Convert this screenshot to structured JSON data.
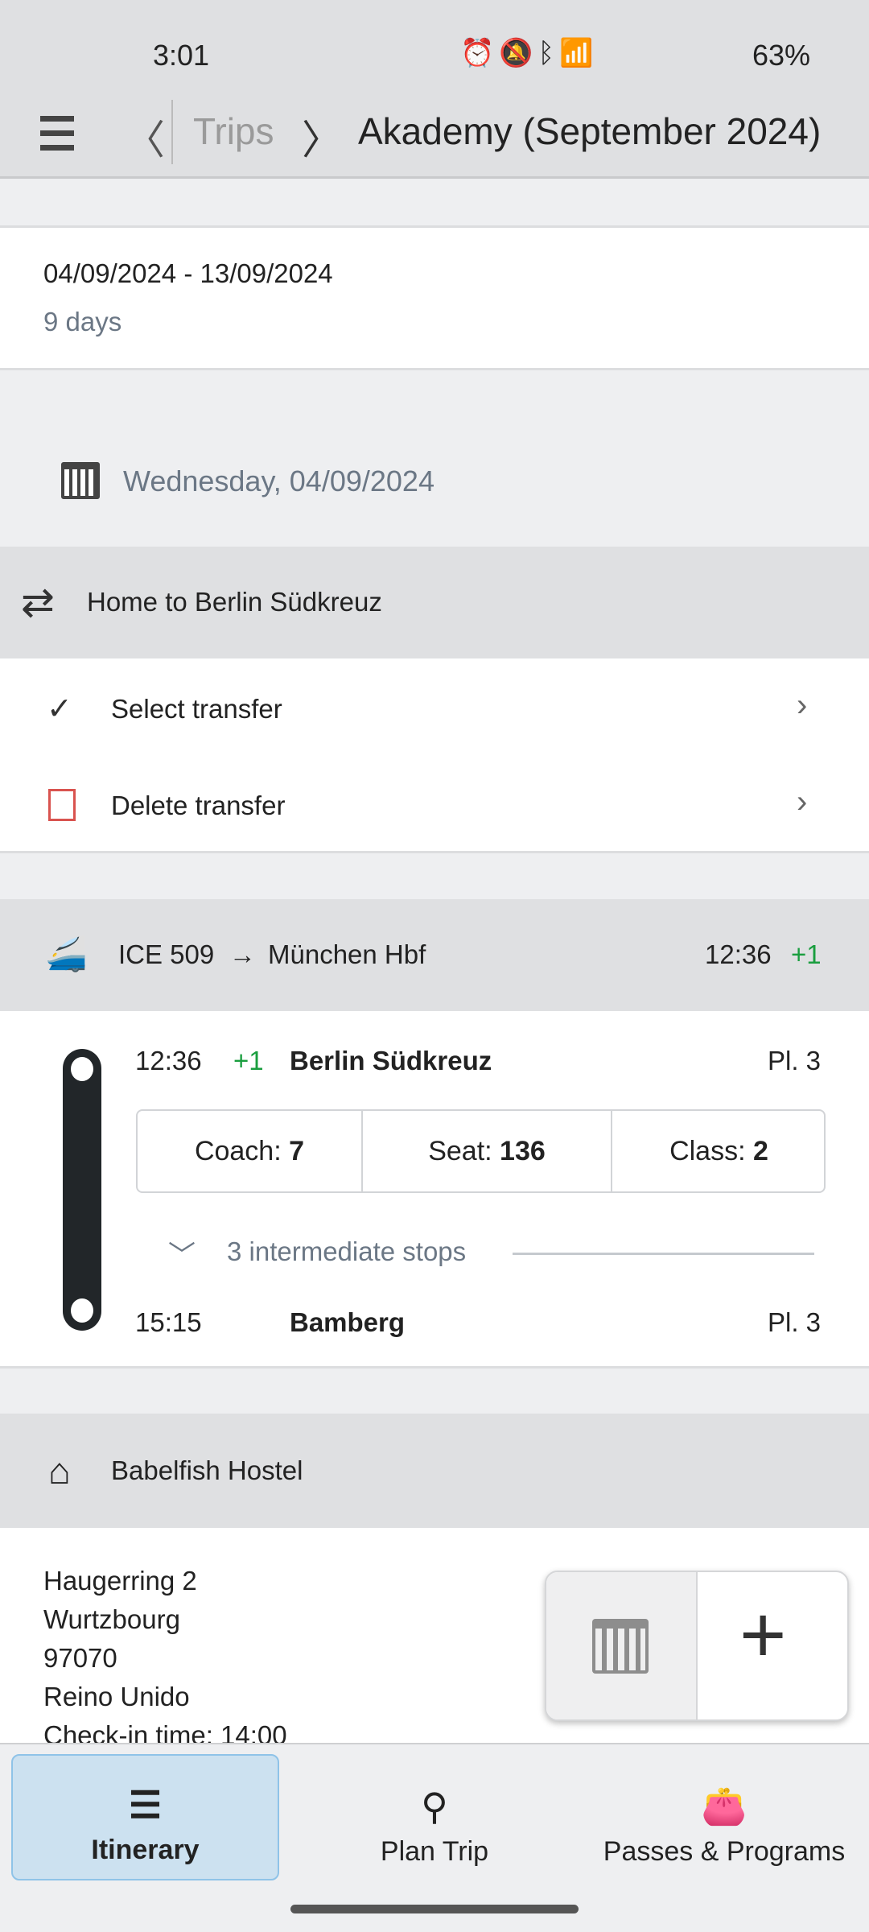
{
  "status_bar": {
    "time": "3:01",
    "battery": "63%"
  },
  "header": {
    "breadcrumb_parent": "Trips",
    "title": "Akademy (September 2024)"
  },
  "trip_summary": {
    "dates": "04/09/2024 - 13/09/2024",
    "duration": "9 days"
  },
  "day": {
    "date": "Wednesday, 04/09/2024"
  },
  "transfer": {
    "title": "Home to Berlin Südkreuz",
    "actions": [
      {
        "label": "Select transfer"
      },
      {
        "label": "Delete transfer"
      }
    ]
  },
  "train": {
    "name": "ICE 509",
    "arrow": "→",
    "destination": "München Hbf",
    "time": "12:36",
    "delay": "+1",
    "departure": {
      "time": "12:36",
      "delay": "+1",
      "station": "Berlin Südkreuz",
      "platform": "Pl. 3"
    },
    "seat_info": {
      "coach_label": "Coach:",
      "coach": "7",
      "seat_label": "Seat:",
      "seat": "136",
      "class_label": "Class:",
      "class": "2"
    },
    "intermediate": "3 intermediate stops",
    "arrival": {
      "time": "15:15",
      "station": "Bamberg",
      "platform": "Pl. 3"
    }
  },
  "accommodation": {
    "name": "Babelfish Hostel",
    "address": [
      "Haugerring 2",
      "Wurtzbourg",
      "97070",
      "Reino Unido"
    ],
    "checkin": "Check-in time: 14:00"
  },
  "bottom_nav": [
    {
      "label": "Itinerary",
      "active": true
    },
    {
      "label": "Plan Trip"
    },
    {
      "label": "Passes & Programs"
    }
  ],
  "colors": {
    "accent_active": "#cce1f0",
    "delay_green": "#1a9e3f",
    "delete_red": "#d9534f"
  }
}
